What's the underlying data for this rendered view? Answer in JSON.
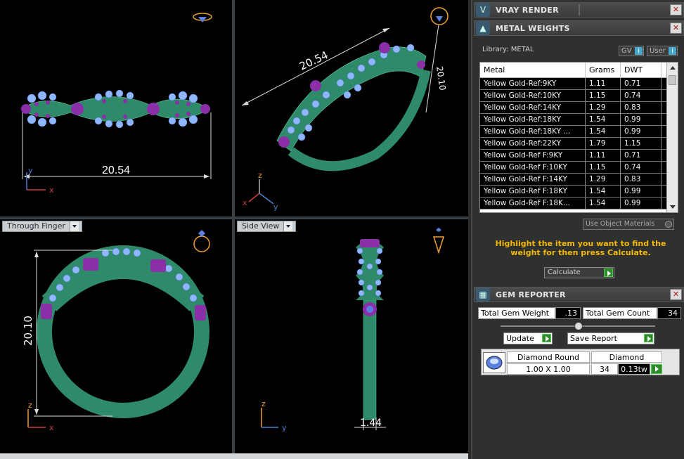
{
  "viewports": {
    "top_left": {
      "dimension": "20.54",
      "axis_x": "x",
      "axis_y": "y"
    },
    "top_right": {
      "dimension": "20.54",
      "dimension_side": "20.10",
      "axis_x": "x",
      "axis_y": "y",
      "axis_z": "z"
    },
    "bottom_left": {
      "title": "Through Finger",
      "dimension": "20.10",
      "axis_x": "x",
      "axis_z": "z"
    },
    "bottom_right": {
      "title": "Side View",
      "dimension": "1.44",
      "axis_y": "y",
      "axis_z": "z"
    }
  },
  "vray": {
    "title": "VRAY RENDER"
  },
  "metal_weights": {
    "title": "METAL WEIGHTS",
    "library_label": "Library: METAL",
    "gv_label": "GV",
    "user_label": "User",
    "columns": [
      "Metal",
      "Grams",
      "DWT"
    ],
    "rows": [
      [
        "Yellow Gold-Ref:9KY",
        "1.11",
        "0.71"
      ],
      [
        "Yellow Gold-Ref:10KY",
        "1.15",
        "0.74"
      ],
      [
        "Yellow Gold-Ref:14KY",
        "1.29",
        "0.83"
      ],
      [
        "Yellow Gold-Ref:18KY",
        "1.54",
        "0.99"
      ],
      [
        "Yellow Gold-Ref:18KY ...",
        "1.54",
        "0.99"
      ],
      [
        "Yellow Gold-Ref:22KY",
        "1.79",
        "1.15"
      ],
      [
        "Yellow Gold-Ref F:9KY",
        "1.11",
        "0.71"
      ],
      [
        "Yellow Gold-Ref F:10KY",
        "1.15",
        "0.74"
      ],
      [
        "Yellow Gold-Ref F:14KY",
        "1.29",
        "0.83"
      ],
      [
        "Yellow Gold-Ref F:18KY",
        "1.54",
        "0.99"
      ],
      [
        "Yellow Gold-Ref F:18K...",
        "1.54",
        "0.99"
      ]
    ],
    "use_object_materials": "Use Object Materials",
    "hint": "Highlight the item you want to find the weight for then press Calculate.",
    "calculate_label": "Calculate"
  },
  "gem_reporter": {
    "title": "GEM REPORTER",
    "total_weight_label": "Total Gem Weight",
    "total_weight_value": ".13",
    "total_count_label": "Total Gem Count",
    "total_count_value": "34",
    "update_label": "Update",
    "save_report_label": "Save Report",
    "gem": {
      "shape_label": "Diamond Round",
      "type_label": "Diamond",
      "size": "1.00 X 1.00",
      "count": "34",
      "weight": "0.13tw"
    }
  },
  "colors": {
    "metal": "#2f8a6a",
    "gem_blue": "#8fb6ff",
    "prong_purple": "#8a2fa8",
    "accent_yellow": "#f3b90a"
  }
}
